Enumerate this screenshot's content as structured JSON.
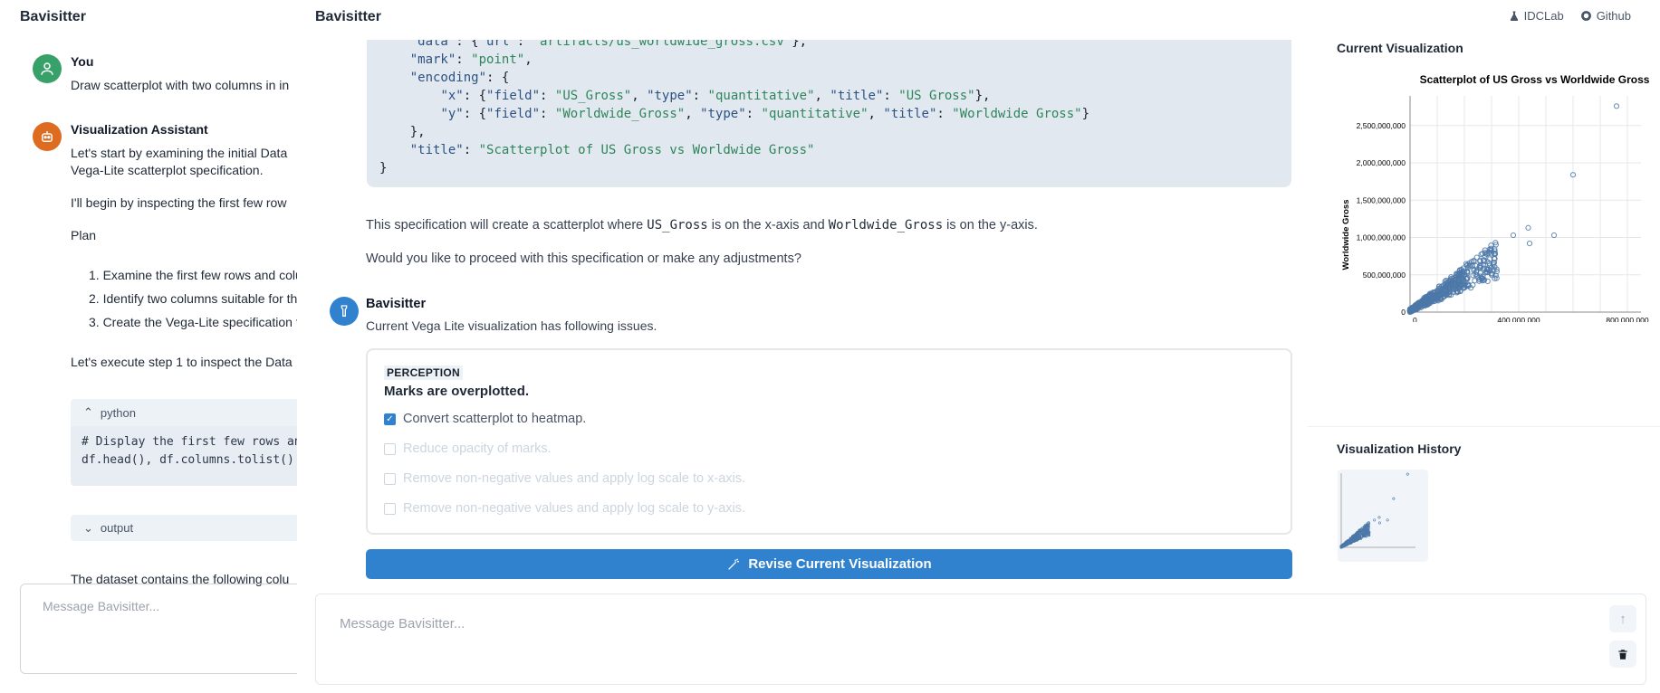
{
  "app": {
    "title": "Bavisitter"
  },
  "left": {
    "messages": [
      {
        "name": "You",
        "text": "Draw scatterplot with two columns in in"
      },
      {
        "name": "Visualization Assistant",
        "lines": [
          "Let's start by examining the initial Data",
          "Vega-Lite scatterplot specification.",
          "I'll begin by inspecting the first few row",
          "Plan"
        ],
        "plan": [
          "1. Examine the first few rows and colu",
          "2. Identify two columns suitable for the",
          "3. Create the Vega-Lite specification f"
        ],
        "after": "Let's execute step 1 to inspect the Data"
      }
    ],
    "code": {
      "lang": "python",
      "lines": [
        "# Display the first few rows an",
        "df.head(), df.columns.tolist()"
      ]
    },
    "output_label": "output",
    "dataset_text": "The dataset contains the following colu",
    "input_placeholder": "Message Bavisitter..."
  },
  "center": {
    "code_lines": [
      "    \"data\": {\"url\": \"artifacts/us_worldwide_gross.csv\"},",
      "    \"mark\": \"point\",",
      "    \"encoding\": {",
      "        \"x\": {\"field\": \"US_Gross\", \"type\": \"quantitative\", \"title\": \"US Gross\"},",
      "        \"y\": {\"field\": \"Worldwide_Gross\", \"type\": \"quantitative\", \"title\": \"Worldwide Gross\"}",
      "    },",
      "    \"title\": \"Scatterplot of US Gross vs Worldwide Gross\"",
      "}"
    ],
    "spec_text_a": "This specification will create a scatterplot where ",
    "spec_code_x": "US_Gross",
    "spec_text_b": " is on the x-axis and ",
    "spec_code_y": "Worldwide_Gross",
    "spec_text_c": " is on the y-axis.",
    "proceed_text": "Would you like to proceed with this specification or make any adjustments?",
    "bot_name": "Bavisitter",
    "bot_text": "Current Vega Lite visualization has following issues.",
    "issue": {
      "tag": "PERCEPTION",
      "title": "Marks are overplotted.",
      "options": [
        {
          "label": "Convert scatterplot to heatmap.",
          "checked": true
        },
        {
          "label": "Reduce opacity of marks.",
          "checked": false
        },
        {
          "label": "Remove non-negative values and apply log scale to x-axis.",
          "checked": false
        },
        {
          "label": "Remove non-negative values and apply log scale to y-axis.",
          "checked": false
        }
      ]
    },
    "revise_label": "Revise Current Visualization",
    "input_placeholder": "Message Bavisitter..."
  },
  "toplinks": {
    "lab": "IDCLab",
    "github": "Github"
  },
  "right": {
    "current_title": "Current Visualization",
    "history_title": "Visualization History"
  },
  "chart_data": {
    "type": "scatter",
    "title": "Scatterplot of US Gross vs Worldwide Gross",
    "xlabel": "US Gross",
    "ylabel": "Worldwide Gross",
    "xlim": [
      0,
      850000000
    ],
    "ylim": [
      0,
      2800000000
    ],
    "xticks": [
      "0",
      "400,000,000",
      "800,000,000"
    ],
    "yticks": [
      "0",
      "500,000,000",
      "1,000,000,000",
      "1,500,000,000",
      "2,000,000,000",
      "2,500,000,000"
    ],
    "ytick_values": [
      0,
      500000000,
      1000000000,
      1500000000,
      2000000000,
      2500000000
    ],
    "xtick_values": [
      0,
      400000000,
      800000000
    ],
    "color": "#4c78a8",
    "outliers": [
      [
        760000000,
        2760000000
      ],
      [
        600000000,
        1840000000
      ],
      [
        530000000,
        1030000000
      ],
      [
        435000000,
        1130000000
      ],
      [
        380000000,
        1030000000
      ],
      [
        440000000,
        920000000
      ]
    ]
  }
}
